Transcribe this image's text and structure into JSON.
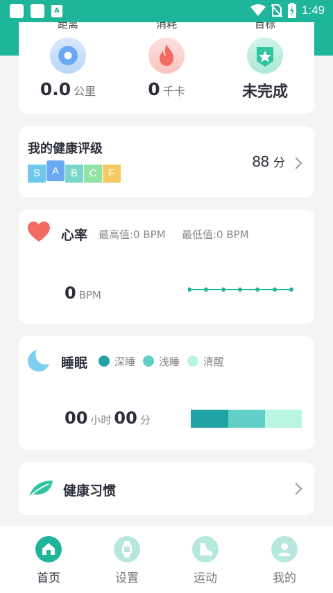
{
  "status_bar": {
    "time": "1:49",
    "app_indicator": "A"
  },
  "stats": {
    "distance": {
      "label": "距离",
      "value": "0.0",
      "unit": "公里",
      "icon": "location-pin-icon"
    },
    "calories": {
      "label": "消耗",
      "value": "0",
      "unit": "千卡",
      "icon": "flame-icon"
    },
    "goal": {
      "label": "目标",
      "value": "未完成",
      "icon": "star-badge-icon"
    }
  },
  "rating": {
    "title": "我的健康评级",
    "grades": [
      "S",
      "A",
      "B",
      "C",
      "F"
    ],
    "active_grade": "A",
    "score": "88",
    "score_unit": "分"
  },
  "heart_rate": {
    "title": "心率",
    "max_label": "最高值:0  BPM",
    "min_label": "最低值:0  BPM",
    "value": "0",
    "unit": "BPM"
  },
  "sleep": {
    "title": "睡眠",
    "legend": [
      {
        "label": "深睡",
        "color": "#1fa3a3"
      },
      {
        "label": "浅睡",
        "color": "#62cfc6"
      },
      {
        "label": "清醒",
        "color": "#b9f6e2"
      }
    ],
    "hours": "00",
    "hours_unit": "小时",
    "minutes": "00",
    "minutes_unit": "分"
  },
  "habit": {
    "title": "健康习惯"
  },
  "nav": [
    {
      "label": "首页",
      "icon": "home-icon",
      "active": true
    },
    {
      "label": "设置",
      "icon": "watch-icon",
      "active": false
    },
    {
      "label": "运动",
      "icon": "shoe-icon",
      "active": false
    },
    {
      "label": "我的",
      "icon": "profile-icon",
      "active": false
    }
  ],
  "colors": {
    "brand": "#1fb59a",
    "grade_s": "#6fc8ec",
    "grade_a": "#6aa9f2",
    "grade_b": "#7ad6c8",
    "grade_c": "#8fe3a3",
    "grade_f": "#f7c964"
  }
}
